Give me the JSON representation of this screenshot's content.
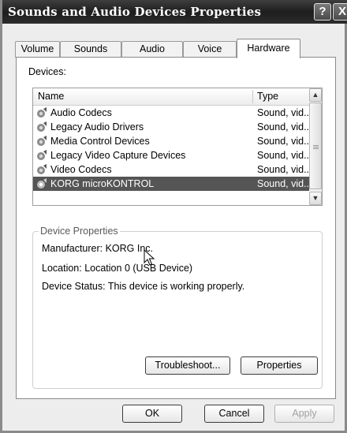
{
  "window": {
    "title": "Sounds and Audio Devices Properties",
    "help_glyph": "?",
    "close_glyph": "X"
  },
  "tabs": [
    {
      "label": "Volume",
      "active": false
    },
    {
      "label": "Sounds",
      "active": false
    },
    {
      "label": "Audio",
      "active": false
    },
    {
      "label": "Voice",
      "active": false
    },
    {
      "label": "Hardware",
      "active": true
    }
  ],
  "devices": {
    "label": "Devices:",
    "columns": {
      "name": "Name",
      "type": "Type"
    },
    "rows": [
      {
        "name": "Audio Codecs",
        "type": "Sound, vid...",
        "icon": "speaker-device-icon",
        "selected": false
      },
      {
        "name": "Legacy Audio Drivers",
        "type": "Sound, vid...",
        "icon": "speaker-device-icon",
        "selected": false
      },
      {
        "name": "Media Control Devices",
        "type": "Sound, vid...",
        "icon": "speaker-device-icon",
        "selected": false
      },
      {
        "name": "Legacy Video Capture Devices",
        "type": "Sound, vid...",
        "icon": "speaker-device-icon",
        "selected": false
      },
      {
        "name": "Video Codecs",
        "type": "Sound, vid...",
        "icon": "speaker-device-icon",
        "selected": false
      },
      {
        "name": "KORG microKONTROL",
        "type": "Sound, vid...",
        "icon": "speaker-device-icon",
        "selected": true
      }
    ],
    "scrollbar": {
      "up_glyph": "▲",
      "down_glyph": "▼"
    }
  },
  "device_properties": {
    "title": "Device Properties",
    "manufacturer": "Manufacturer: KORG Inc.",
    "location": "Location: Location 0 (USB Device)",
    "status": "Device Status: This device is working properly.",
    "troubleshoot_label": "Troubleshoot...",
    "properties_label": "Properties"
  },
  "dialog_buttons": {
    "ok": "OK",
    "cancel": "Cancel",
    "apply": "Apply"
  }
}
